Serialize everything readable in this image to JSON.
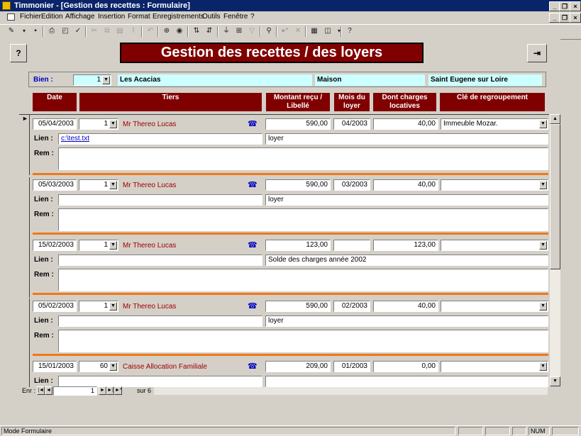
{
  "window": {
    "title": "Timmonier - [Gestion des recettes : Formulaire]",
    "minimize": "_",
    "restore": "❐",
    "close": "×"
  },
  "menu": [
    "Fichier",
    "Edition",
    "Affichage",
    "Insertion",
    "Format",
    "Enregistrements",
    "Outils",
    "Fenêtre",
    "?"
  ],
  "toolbar_icons": [
    "design-view-icon",
    "save-icon",
    "print-icon",
    "print-preview-icon",
    "spelling-icon",
    "cut-icon",
    "copy-icon",
    "paste-icon",
    "format-painter-icon",
    "undo-icon",
    "insert-hyperlink-icon",
    "web-toolbar-icon",
    "sort-ascending-icon",
    "sort-descending-icon",
    "filter-by-selection-icon",
    "filter-by-form-icon",
    "apply-filter-icon",
    "find-icon",
    "new-record-icon",
    "delete-record-icon",
    "database-window-icon",
    "new-object-icon",
    "help-icon"
  ],
  "form": {
    "title": "Gestion des recettes / des loyers",
    "help_button": "?",
    "exit_button": "⇥",
    "bien_label": "Bien :",
    "bien_id": "1",
    "bien_name": "Les Acacias",
    "bien_type": "Maison",
    "bien_city": "Saint Eugene sur Loire",
    "headers": {
      "date": "Date",
      "tiers": "Tiers",
      "montant": "Montant reçu / Libellé",
      "mois": "Mois du loyer",
      "charges": "Dont charges locatives",
      "cle": "Clé de regroupement"
    },
    "labels": {
      "lien": "Lien :",
      "rem": "Rem :"
    }
  },
  "records": [
    {
      "date": "05/04/2003",
      "tiers_id": "1",
      "tiers_name": "Mr Thereo Lucas",
      "montant": "590,00",
      "mois": "04/2003",
      "charges": "40,00",
      "cle": "Immeuble Mozar.",
      "lien": "c:\\test.txt",
      "libelle": "loyer",
      "rem": ""
    },
    {
      "date": "05/03/2003",
      "tiers_id": "1",
      "tiers_name": "Mr Thereo Lucas",
      "montant": "590,00",
      "mois": "03/2003",
      "charges": "40,00",
      "cle": "",
      "lien": "",
      "libelle": "loyer",
      "rem": ""
    },
    {
      "date": "15/02/2003",
      "tiers_id": "1",
      "tiers_name": "Mr Thereo Lucas",
      "montant": "123,00",
      "mois": "",
      "charges": "123,00",
      "cle": "",
      "lien": "",
      "libelle": "Solde des charges année 2002",
      "rem": ""
    },
    {
      "date": "05/02/2003",
      "tiers_id": "1",
      "tiers_name": "Mr Thereo Lucas",
      "montant": "590,00",
      "mois": "02/2003",
      "charges": "40,00",
      "cle": "",
      "lien": "",
      "libelle": "loyer",
      "rem": ""
    },
    {
      "date": "15/01/2003",
      "tiers_id": "60",
      "tiers_name": "Caisse Allocation Familiale",
      "montant": "209,00",
      "mois": "01/2003",
      "charges": "0,00",
      "cle": "",
      "lien": "",
      "libelle": "",
      "rem": ""
    }
  ],
  "navigation": {
    "label": "Enr :",
    "current": "1",
    "total_text": "sur 6"
  },
  "status": {
    "mode": "Mode Formulaire",
    "num": "NUM"
  }
}
